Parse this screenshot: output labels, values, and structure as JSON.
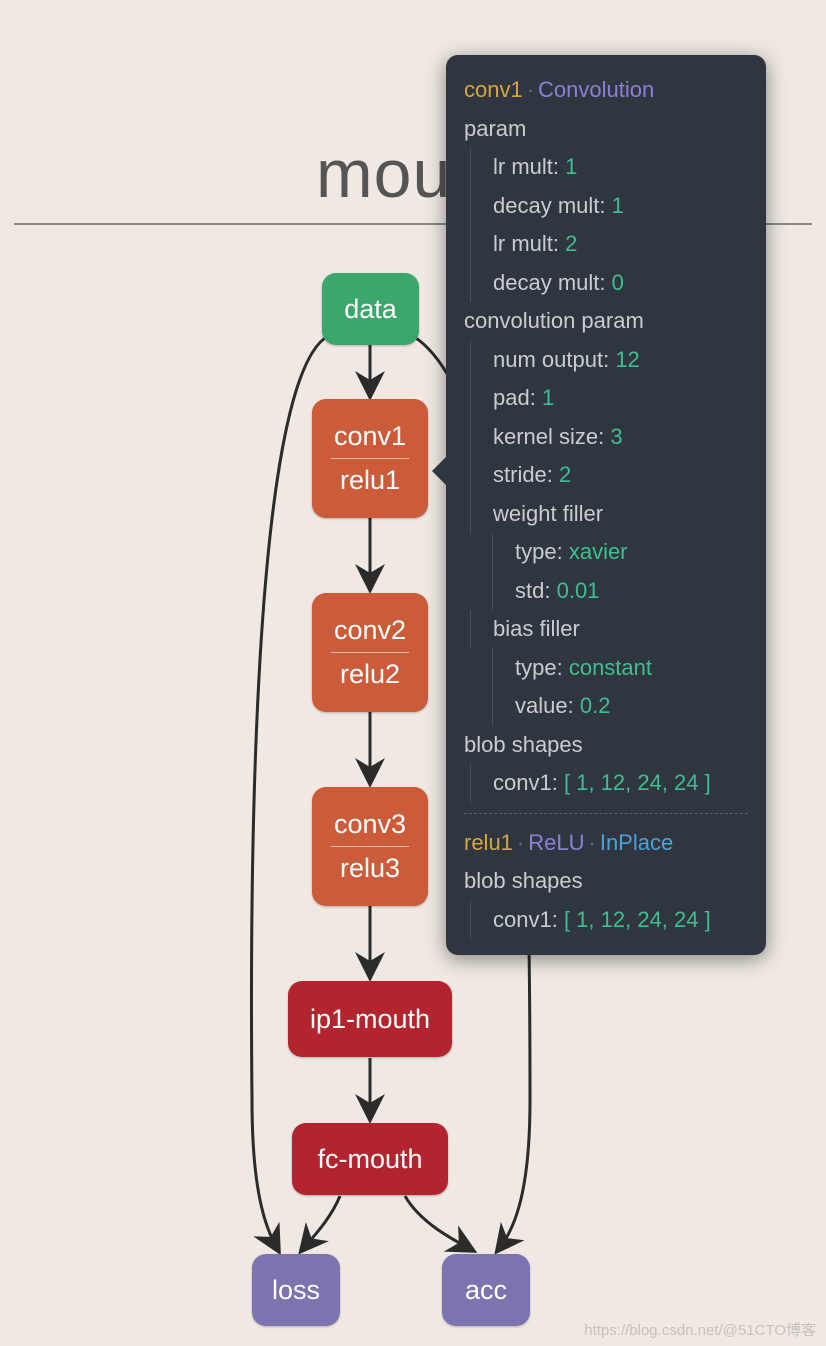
{
  "title": "mouth",
  "nodes": {
    "data": "data",
    "conv1": "conv1",
    "relu1": "relu1",
    "conv2": "conv2",
    "relu2": "relu2",
    "conv3": "conv3",
    "relu3": "relu3",
    "ip1": "ip1-mouth",
    "fc": "fc-mouth",
    "loss": "loss",
    "acc": "acc"
  },
  "tooltip": {
    "layer1": {
      "name": "conv1",
      "type": "Convolution",
      "sections": {
        "param_label": "param",
        "param": [
          {
            "k": "lr mult:",
            "v": "1"
          },
          {
            "k": "decay mult:",
            "v": "1"
          },
          {
            "k": "lr mult:",
            "v": "2"
          },
          {
            "k": "decay mult:",
            "v": "0"
          }
        ],
        "conv_label": "convolution param",
        "conv": [
          {
            "k": "num output:",
            "v": "12"
          },
          {
            "k": "pad:",
            "v": "1"
          },
          {
            "k": "kernel size:",
            "v": "3"
          },
          {
            "k": "stride:",
            "v": "2"
          }
        ],
        "weight_filler_label": "weight filler",
        "weight_filler": [
          {
            "k": "type:",
            "v": "xavier"
          },
          {
            "k": "std:",
            "v": "0.01"
          }
        ],
        "bias_filler_label": "bias filler",
        "bias_filler": [
          {
            "k": "type:",
            "v": "constant"
          },
          {
            "k": "value:",
            "v": "0.2"
          }
        ],
        "blob_label": "blob shapes",
        "blob": {
          "k": "conv1:",
          "v": "[ 1, 12, 24, 24 ]"
        }
      }
    },
    "layer2": {
      "name": "relu1",
      "type": "ReLU",
      "inplace": "InPlace",
      "blob_label": "blob shapes",
      "blob": {
        "k": "conv1:",
        "v": "[ 1, 12, 24, 24 ]"
      }
    }
  },
  "watermark": "https://blog.csdn.net/@51CTO博客"
}
